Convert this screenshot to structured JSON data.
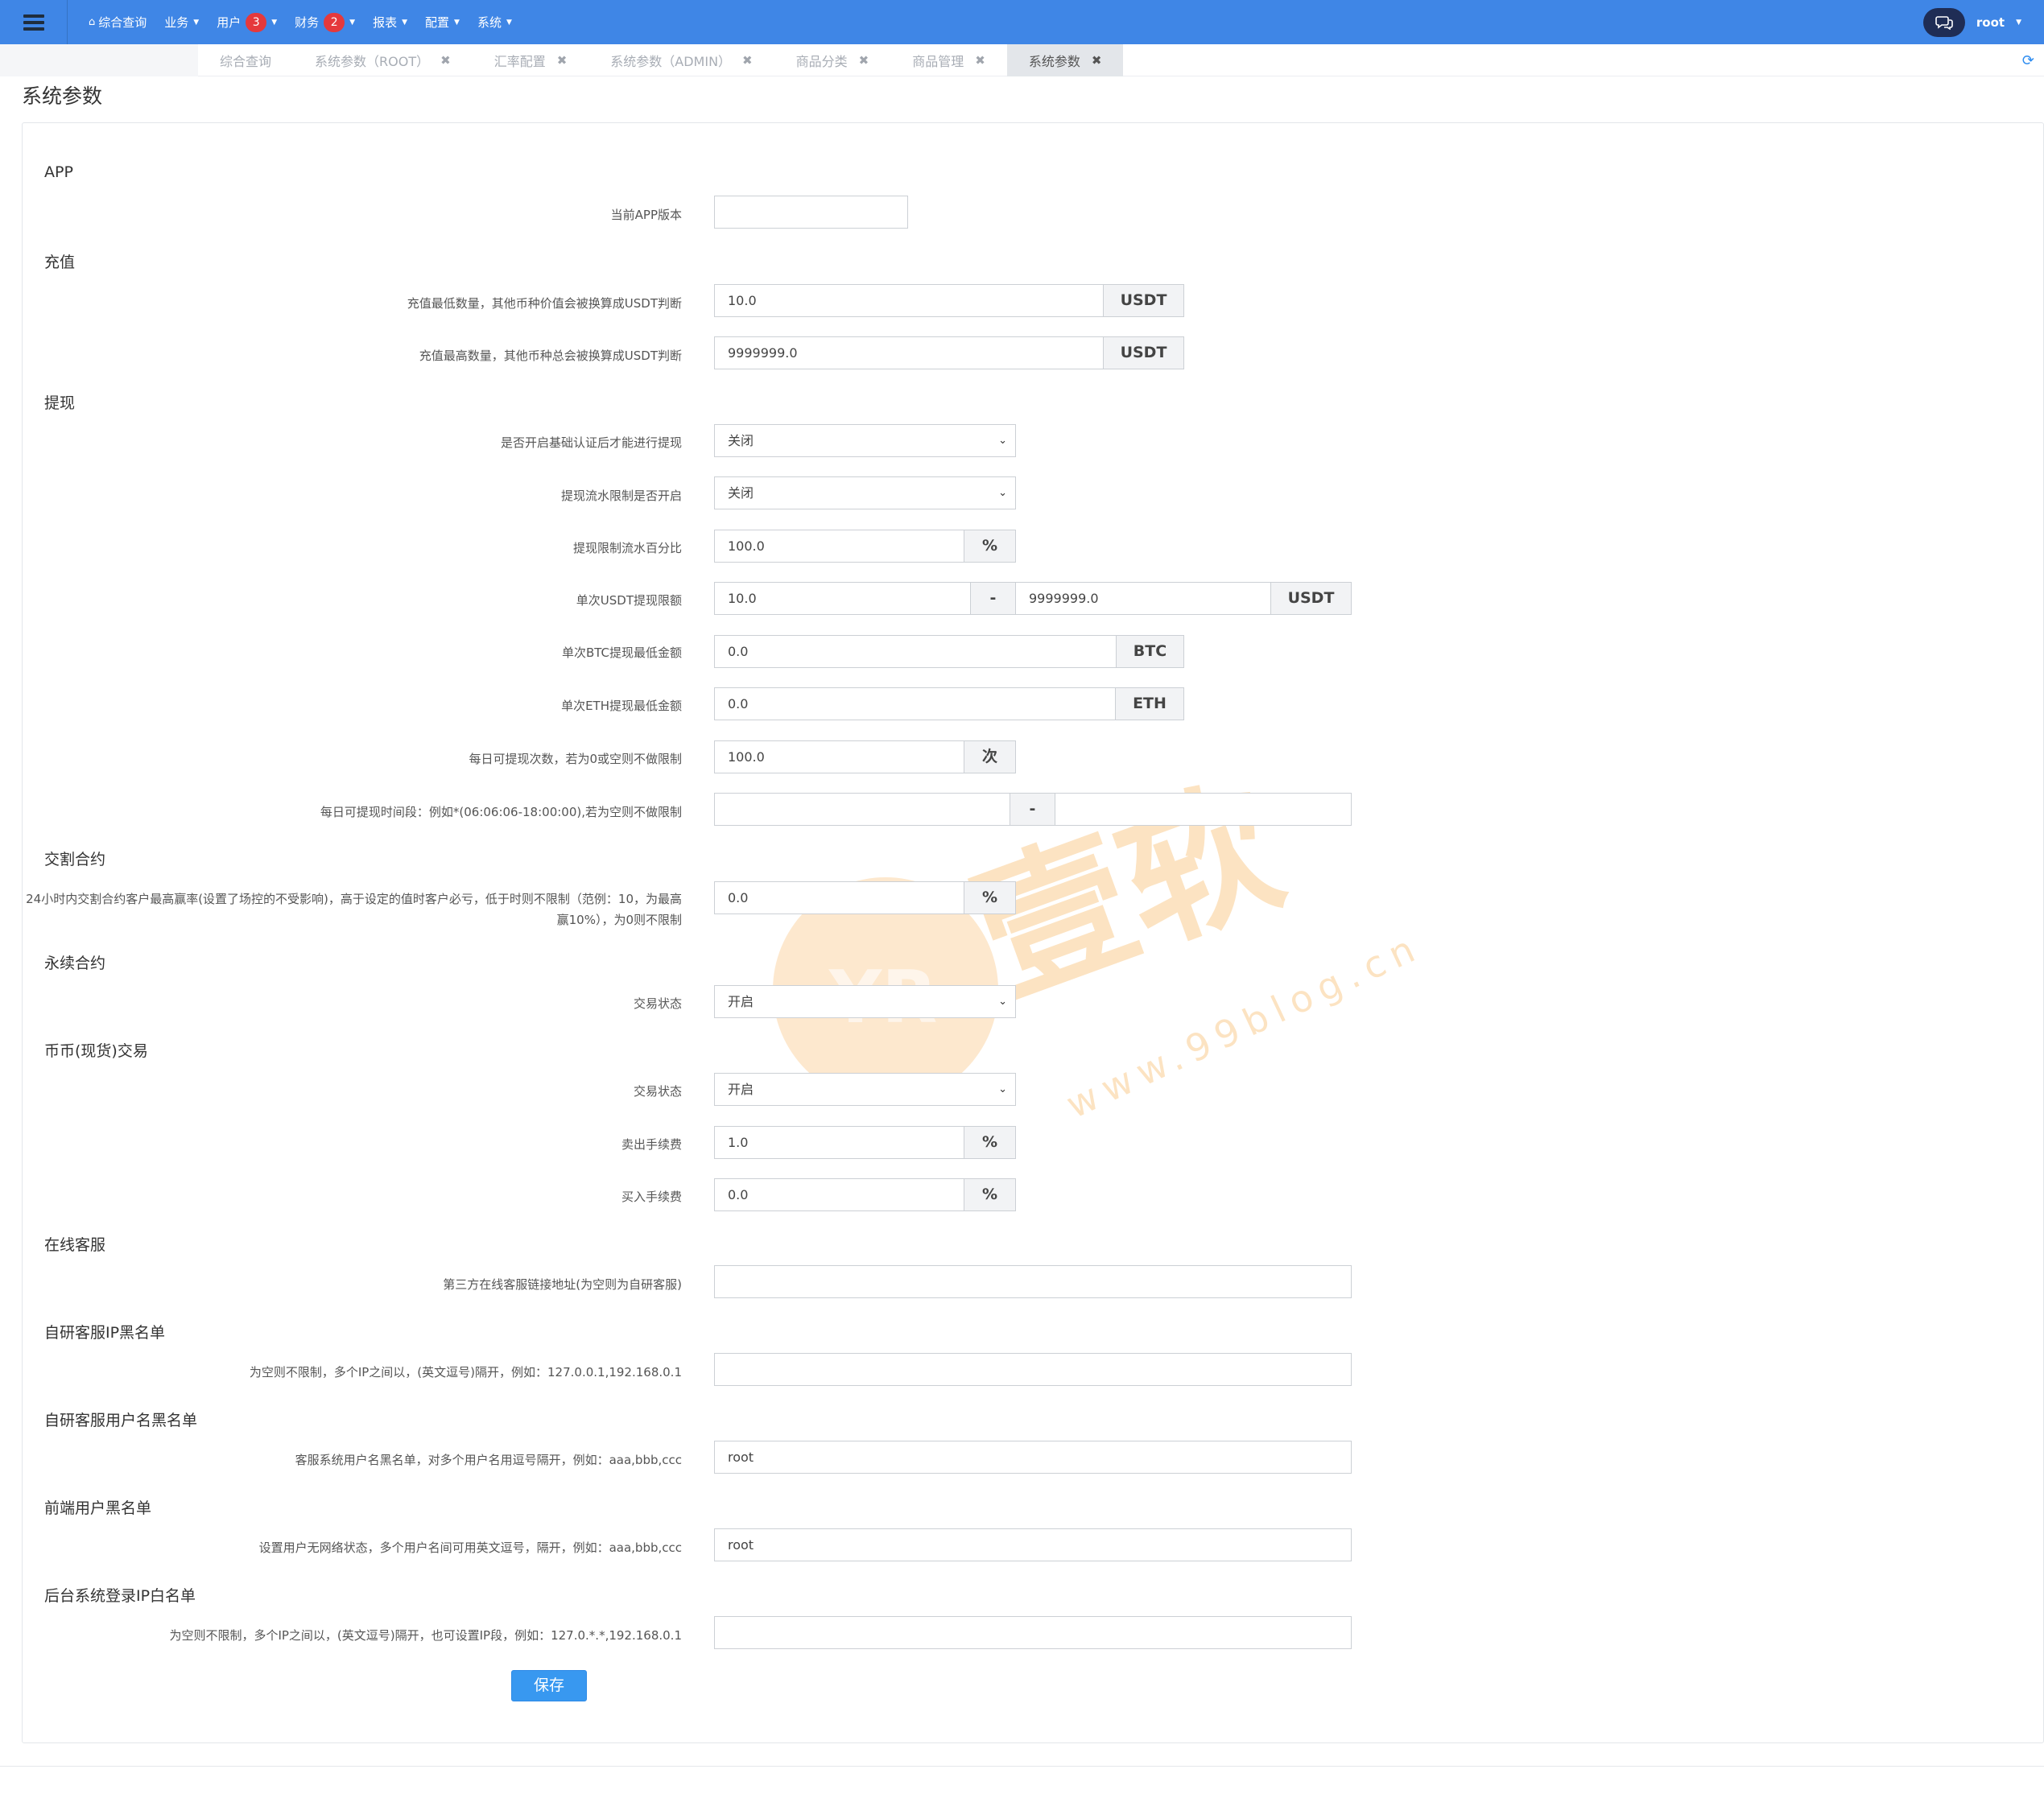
{
  "navbar": {
    "menu": [
      {
        "label": "综合查询",
        "home": true
      },
      {
        "label": "业务",
        "caret": true
      },
      {
        "label": "用户",
        "badge": "3",
        "caret": true
      },
      {
        "label": "财务",
        "badge": "2",
        "caret": true
      },
      {
        "label": "报表",
        "caret": true
      },
      {
        "label": "配置",
        "caret": true
      },
      {
        "label": "系统",
        "caret": true
      }
    ],
    "user": "root"
  },
  "tabs": [
    {
      "label": "综合查询",
      "closable": false
    },
    {
      "label": "系统参数（ROOT）",
      "closable": true
    },
    {
      "label": "汇率配置",
      "closable": true
    },
    {
      "label": "系统参数（ADMIN）",
      "closable": true
    },
    {
      "label": "商品分类",
      "closable": true
    },
    {
      "label": "商品管理",
      "closable": true
    },
    {
      "label": "系统参数",
      "closable": true,
      "active": true
    }
  ],
  "page": {
    "title": "系统参数"
  },
  "sections": {
    "app": "APP",
    "recharge": "充值",
    "withdraw": "提现",
    "delivery": "交割合约",
    "perpetual": "永续合约",
    "spot": "币币(现货)交易",
    "online_cs": "在线客服",
    "cs_ip_blacklist": "自研客服IP黑名单",
    "cs_user_blacklist": "自研客服用户名黑名单",
    "front_user_blacklist": "前端用户黑名单",
    "admin_ip_whitelist": "后台系统登录IP白名单"
  },
  "fields": {
    "app_version": {
      "label": "当前APP版本",
      "value": ""
    },
    "recharge_min": {
      "label": "充值最低数量，其他币种价值会被换算成USDT判断",
      "value": "10.0",
      "unit": "USDT"
    },
    "recharge_max": {
      "label": "充值最高数量，其他币种总会被换算成USDT判断",
      "value": "9999999.0",
      "unit": "USDT"
    },
    "withdraw_kyc": {
      "label": "是否开启基础认证后才能进行提现",
      "value": "关闭"
    },
    "withdraw_flow_limit": {
      "label": "提现流水限制是否开启",
      "value": "关闭"
    },
    "withdraw_flow_percent": {
      "label": "提现限制流水百分比",
      "value": "100.0",
      "unit": "%"
    },
    "withdraw_usdt_limit": {
      "label": "单次USDT提现限额",
      "min": "10.0",
      "sep": "-",
      "max": "9999999.0",
      "unit": "USDT"
    },
    "withdraw_btc_min": {
      "label": "单次BTC提现最低金额",
      "value": "0.0",
      "unit": "BTC"
    },
    "withdraw_eth_min": {
      "label": "单次ETH提现最低金额",
      "value": "0.0",
      "unit": "ETH"
    },
    "withdraw_daily_count": {
      "label": "每日可提现次数，若为0或空则不做限制",
      "value": "100.0",
      "unit": "次"
    },
    "withdraw_daily_time": {
      "label": "每日可提现时间段：例如*(06:06:06-18:00:00),若为空则不做限制",
      "start": "",
      "sep": "-",
      "end": ""
    },
    "delivery_max_win": {
      "label": "24小时内交割合约客户最高赢率(设置了场控的不受影响)，高于设定的值时客户必亏，低于时则不限制（范例：10，为最高赢10%），为0则不限制",
      "value": "0.0",
      "unit": "%"
    },
    "perpetual_status": {
      "label": "交易状态",
      "value": "开启"
    },
    "spot_status": {
      "label": "交易状态",
      "value": "开启"
    },
    "spot_sell_fee": {
      "label": "卖出手续费",
      "value": "1.0",
      "unit": "%"
    },
    "spot_buy_fee": {
      "label": "买入手续费",
      "value": "0.0",
      "unit": "%"
    },
    "cs_link": {
      "label": "第三方在线客服链接地址(为空则为自研客服)",
      "value": ""
    },
    "cs_ip_blacklist": {
      "label": "为空则不限制，多个IP之间以，(英文逗号)隔开，例如：127.0.0.1,192.168.0.1",
      "value": ""
    },
    "cs_user_blacklist": {
      "label": "客服系统用户名黑名单，对多个用户名用逗号隔开，例如：aaa,bbb,ccc",
      "value": "root"
    },
    "front_user_blacklist": {
      "label": "设置用户无网络状态，多个用户名间可用英文逗号，隔开，例如：aaa,bbb,ccc",
      "value": "root"
    },
    "admin_ip_whitelist": {
      "label": "为空则不限制，多个IP之间以，(英文逗号)隔开，也可设置IP段，例如：127.0.*.*,192.168.0.1",
      "value": ""
    }
  },
  "save_label": "保存",
  "watermark": {
    "brand": "壹软",
    "url": "www.99blog.cn",
    "logo": "YR"
  }
}
